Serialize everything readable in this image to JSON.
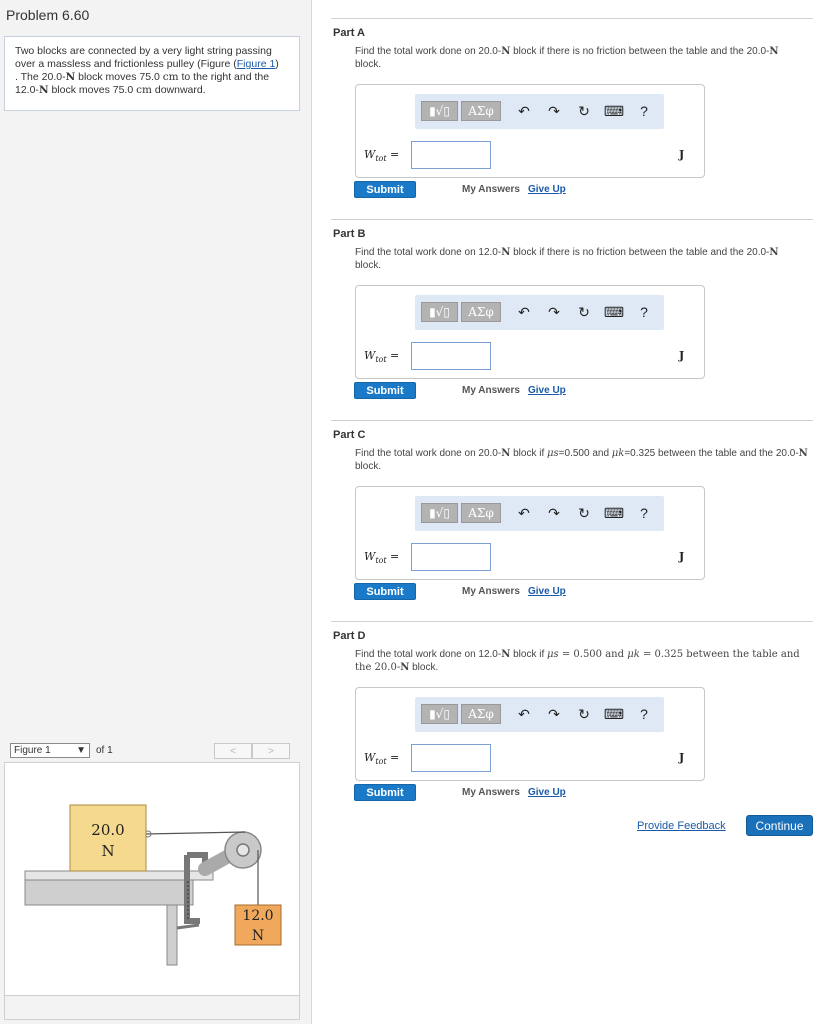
{
  "problem": {
    "title": "Problem 6.60",
    "text_1": "Two blocks are connected by a very light string passing over a massless and frictionless pulley (Figure (",
    "figure_link": "Figure 1",
    "text_2": ")",
    "text_3": ". The 20.0-",
    "unit_N": "N",
    "text_4": " block moves 75.0 ",
    "unit_cm": "cm",
    "text_5": " to the right and the 12.0-",
    "text_6": " block moves 75.0 ",
    "text_7": " downward."
  },
  "figure": {
    "selector_label": "Figure 1",
    "of_label": "of 1",
    "prev_label": "<",
    "next_label": ">",
    "block_table_line1": "20.0",
    "block_table_line2": "N",
    "block_hanging_line1": "12.0",
    "block_hanging_line2": "N"
  },
  "toolbar": {
    "templates": "▮√▯",
    "symbols": "ΑΣφ",
    "undo": "↶",
    "redo": "↷",
    "reset": "↻",
    "keyboard": "⌨",
    "help": "?"
  },
  "parts": [
    {
      "title": "Part A",
      "question_a": "Find the total work done on 20.0-",
      "question_b": " block if there is no friction between the table and the 20.0-",
      "question_c": " block.",
      "var": "W",
      "var_sub": "tot",
      "eq": " =",
      "value": "",
      "unit": "J",
      "submit": "Submit",
      "my_answers": "My Answers",
      "give_up": "Give Up"
    },
    {
      "title": "Part B",
      "question_a": "Find the total work done on 12.0-",
      "question_b": " block if there is no friction between the table and the 20.0-",
      "question_c": " block.",
      "var": "W",
      "var_sub": "tot",
      "eq": " =",
      "value": "",
      "unit": "J",
      "submit": "Submit",
      "my_answers": "My Answers",
      "give_up": "Give Up"
    },
    {
      "title": "Part C",
      "question_a": "Find the total work done on 20.0-",
      "question_b": " block if ",
      "mu_s": "μs",
      "mu_s_val": "=0.500 and ",
      "mu_k": "μk",
      "mu_k_val": "=0.325 between the table and the 20.0-",
      "question_c": " block.",
      "var": "W",
      "var_sub": "tot",
      "eq": " =",
      "value": "",
      "unit": "J",
      "submit": "Submit",
      "my_answers": "My Answers",
      "give_up": "Give Up"
    },
    {
      "title": "Part D",
      "question_a": "Find the total work done on 12.0-",
      "question_b": " block if ",
      "mu_s": "μs",
      "mu_s_val": " = 0.500 and ",
      "mu_k": "μk",
      "mu_k_val": " = 0.325 between the table and the 20.0-",
      "question_c": " block.",
      "var": "W",
      "var_sub": "tot",
      "eq": " =",
      "value": "",
      "unit": "J",
      "submit": "Submit",
      "my_answers": "My Answers",
      "give_up": "Give Up"
    }
  ],
  "unit_N": "N",
  "footer": {
    "feedback": "Provide Feedback",
    "continue": "Continue"
  }
}
